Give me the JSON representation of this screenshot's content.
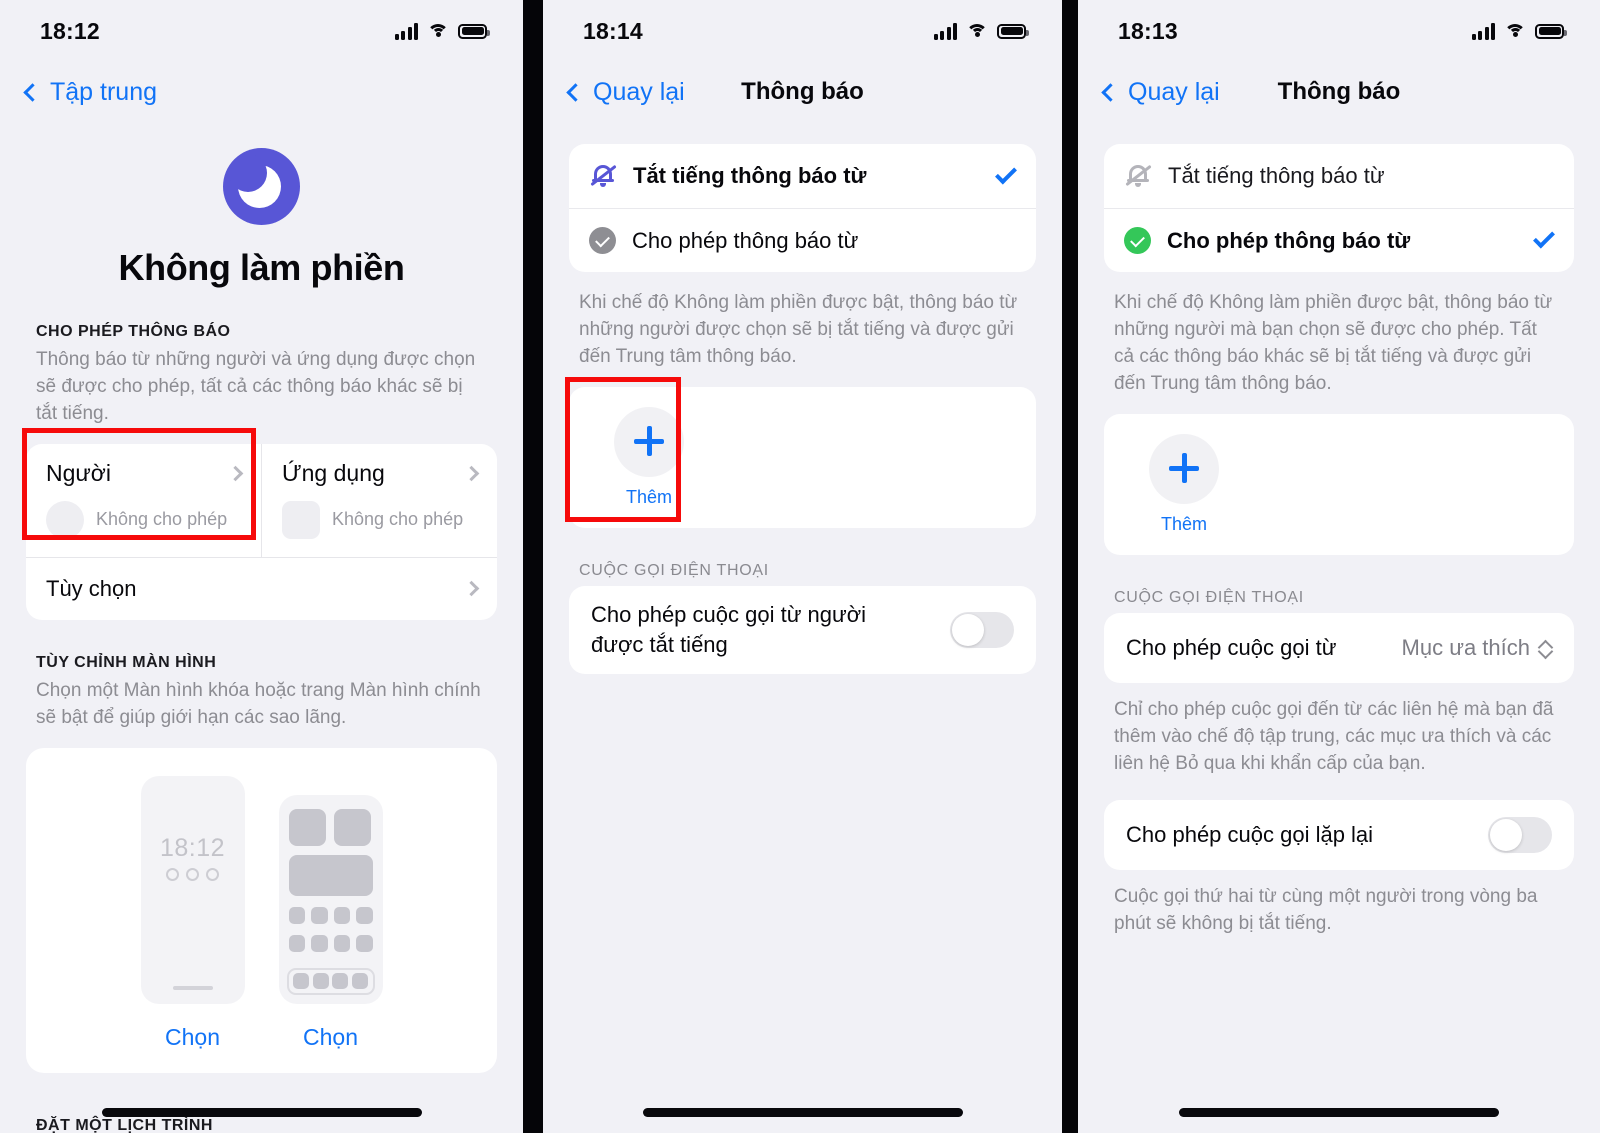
{
  "panel1": {
    "status": {
      "time": "18:12",
      "signal_icon": "cellular-bars-icon",
      "wifi_icon": "wifi-icon",
      "battery_icon": "battery-full-icon"
    },
    "nav": {
      "back_label": "Tập trung",
      "back_icon": "chevron-left-icon"
    },
    "hero": {
      "icon": "crescent-moon-icon",
      "accent": "#5856d6",
      "title": "Không làm phiền"
    },
    "section_notifications": {
      "header": "CHO PHÉP THÔNG BÁO",
      "description": "Thông báo từ những người và ứng dụng được chọn sẽ được cho phép, tất cả các thông báo khác sẽ bị tắt tiếng.",
      "tiles": [
        {
          "title": "Người",
          "status": "Không cho phép",
          "placeholder": "circle-avatar-placeholder",
          "chevron": "chevron-right-icon"
        },
        {
          "title": "Ứng dụng",
          "status": "Không cho phép",
          "placeholder": "square-app-placeholder",
          "chevron": "chevron-right-icon"
        }
      ],
      "options_row": {
        "label": "Tùy chọn",
        "chevron": "chevron-right-icon"
      }
    },
    "section_screen": {
      "header": "TÙY CHỈNH MÀN HÌNH",
      "description": "Chọn một Màn hình khóa hoặc trang Màn hình chính sẽ bật để giúp giới hạn các sao lãng.",
      "lock_preview_time": "18:12",
      "actions": [
        "Chọn",
        "Chọn"
      ]
    },
    "section_schedule": {
      "header": "ĐẶT MỘT LỊCH TRÌNH"
    },
    "highlight_color": "#f60a0a"
  },
  "panel2": {
    "status": {
      "time": "18:14",
      "signal_icon": "cellular-bars-icon",
      "wifi_icon": "wifi-icon",
      "battery_icon": "battery-full-icon"
    },
    "nav": {
      "back_label": "Quay lại",
      "title": "Thông báo",
      "back_icon": "chevron-left-icon"
    },
    "options": [
      {
        "label": "Tắt tiếng thông báo từ",
        "icon": "bell-slash-icon",
        "icon_color": "#5856d6",
        "selected": true,
        "check_icon": "checkmark-icon"
      },
      {
        "label": "Cho phép thông báo từ",
        "icon": "checkmark-badge-icon",
        "icon_color": "#8e8e93",
        "selected": false
      }
    ],
    "description": "Khi chế độ Không làm phiền được bật, thông báo từ những người được chọn sẽ bị tắt tiếng và được gửi đến Trung tâm thông báo.",
    "add": {
      "label": "Thêm",
      "icon": "plus-icon"
    },
    "section_calls": {
      "header": "CUỘC GỌI ĐIỆN THOẠI",
      "row_label": "Cho phép cuộc gọi từ người được tắt tiếng",
      "toggle_state": "off"
    },
    "highlight_color": "#f60a0a"
  },
  "panel3": {
    "status": {
      "time": "18:13",
      "signal_icon": "cellular-bars-icon",
      "wifi_icon": "wifi-icon",
      "battery_icon": "battery-full-icon"
    },
    "nav": {
      "back_label": "Quay lại",
      "title": "Thông báo",
      "back_icon": "chevron-left-icon"
    },
    "options": [
      {
        "label": "Tắt tiếng thông báo từ",
        "icon": "bell-slash-icon",
        "icon_color": "#b4b4ba",
        "selected": false
      },
      {
        "label": "Cho phép thông báo từ",
        "icon": "checkmark-badge-icon",
        "icon_color": "#34c759",
        "selected": true,
        "check_icon": "checkmark-icon"
      }
    ],
    "description": "Khi chế độ Không làm phiền được bật, thông báo từ những người mà bạn chọn sẽ được cho phép. Tất cả các thông báo khác sẽ bị tắt tiếng và được gửi đến Trung tâm thông báo.",
    "add": {
      "label": "Thêm",
      "icon": "plus-icon"
    },
    "section_calls": {
      "header": "CUỘC GỌI ĐIỆN THOẠI",
      "allow_from_label": "Cho phép cuộc gọi từ",
      "allow_from_value": "Mục ưa thích",
      "allow_from_icon": "up-down-chevron-icon",
      "allow_from_description": "Chỉ cho phép cuộc gọi đến từ các liên hệ mà bạn đã thêm vào chế độ tập trung, các mục ưa thích và các liên hệ Bỏ qua khi khẩn cấp của bạn.",
      "repeat_label": "Cho phép cuộc gọi lặp lại",
      "repeat_toggle_state": "off",
      "repeat_description": "Cuộc gọi thứ hai từ cùng một người trong vòng ba phút sẽ không bị tắt tiếng."
    }
  }
}
